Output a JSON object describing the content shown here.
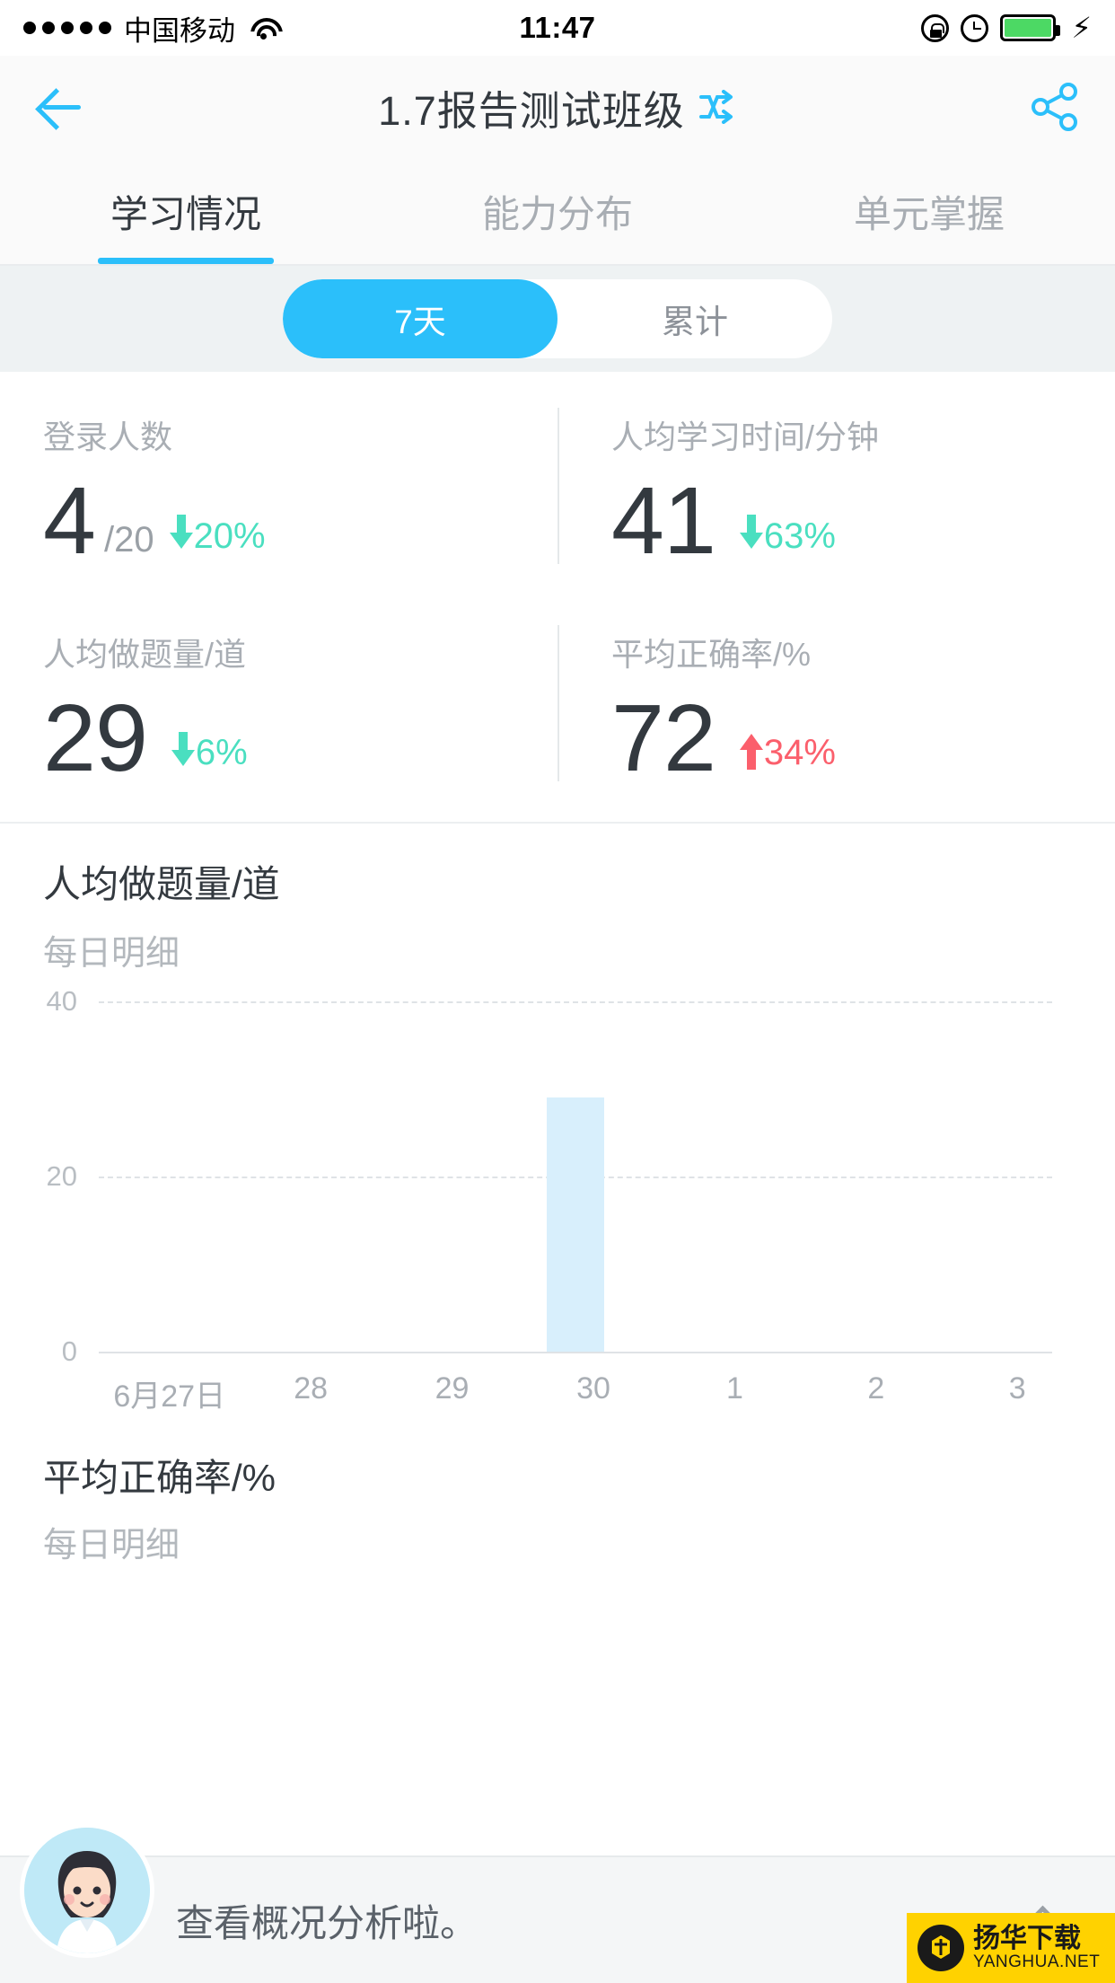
{
  "status_bar": {
    "signal_dots": 5,
    "carrier": "中国移动",
    "wifi_icon": "wifi-icon",
    "time": "11:47",
    "rotation_lock_icon": "rotation-lock-icon",
    "alarm_icon": "alarm-icon",
    "battery_icon": "battery-icon",
    "charging_icon": "⚡"
  },
  "navbar": {
    "back_icon": "back-arrow-icon",
    "title": "1.7报告测试班级",
    "switch_icon": "shuffle-switch-icon",
    "share_icon": "share-icon"
  },
  "tabs": [
    {
      "label": "学习情况",
      "active": true
    },
    {
      "label": "能力分布",
      "active": false
    },
    {
      "label": "单元掌握",
      "active": false
    }
  ],
  "segment": {
    "options": [
      {
        "label": "7天",
        "active": true
      },
      {
        "label": "累计",
        "active": false
      }
    ]
  },
  "stats": [
    {
      "label": "登录人数",
      "value": "4",
      "total": "/20",
      "delta": "20%",
      "direction": "down",
      "arrow_icon": "arrow-down-icon"
    },
    {
      "label": "人均学习时间/分钟",
      "value": "41",
      "total": "",
      "delta": "63%",
      "direction": "down",
      "arrow_icon": "arrow-down-icon"
    },
    {
      "label": "人均做题量/道",
      "value": "29",
      "total": "",
      "delta": "6%",
      "direction": "down",
      "arrow_icon": "arrow-down-icon"
    },
    {
      "label": "平均正确率/%",
      "value": "72",
      "total": "",
      "delta": "34%",
      "direction": "up",
      "arrow_icon": "arrow-up-icon"
    }
  ],
  "chart_section": {
    "title": "人均做题量/道",
    "subtitle": "每日明细"
  },
  "chart_data": {
    "type": "bar",
    "title": "人均做题量/道",
    "subtitle": "每日明细",
    "categories": [
      "6月27日",
      "28",
      "29",
      "30",
      "1",
      "2",
      "3"
    ],
    "values": [
      0,
      0,
      0,
      29,
      0,
      0,
      0
    ],
    "yticks": [
      0,
      20,
      40
    ],
    "ylim": [
      0,
      40
    ],
    "xlabel": "",
    "ylabel": "",
    "grid": true,
    "grid_style": "dashed",
    "bar_color": "#D8EFFC",
    "legend": null
  },
  "next_section": {
    "title": "平均正确率/%",
    "subtitle": "每日明细"
  },
  "assistant": {
    "avatar_icon": "assistant-avatar",
    "message": "查看概况分析啦。",
    "expand_icon": "chevron-up-icon"
  },
  "watermark": {
    "main": "扬华下载",
    "sub": "YANGHUA.NET",
    "logo_icon": "yanghua-logo-icon"
  },
  "colors": {
    "accent_blue": "#2BBFFA",
    "down_green": "#4ADFC0",
    "up_red": "#FB5F6C",
    "bar_blue": "#D8EFFC",
    "text_dark": "#33393F",
    "text_muted": "#a9aeb4"
  }
}
